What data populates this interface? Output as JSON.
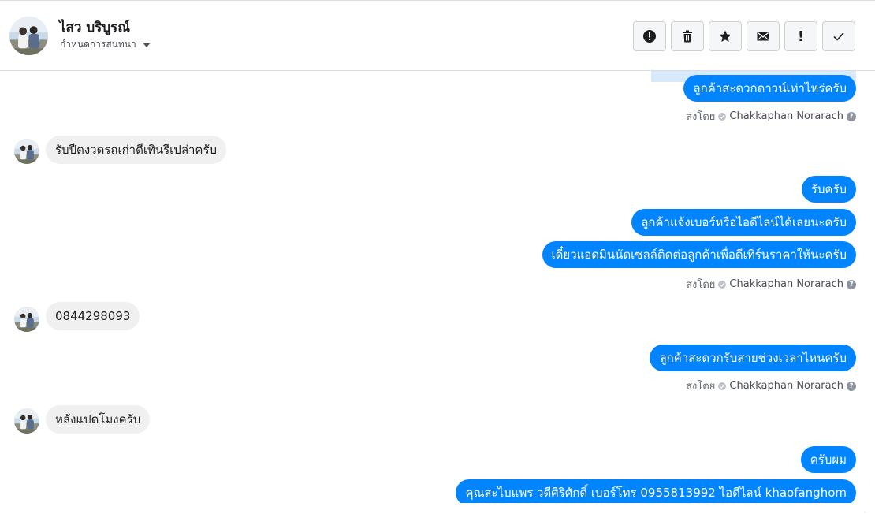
{
  "header": {
    "contact_name": "ไสว บริบูรณ์",
    "conversation_settings_label": "กำหนดการสนทนา",
    "actions": [
      {
        "icon": "report-spam-icon"
      },
      {
        "icon": "trash-icon"
      },
      {
        "icon": "star-icon"
      },
      {
        "icon": "envelope-icon"
      },
      {
        "icon": "exclamation-icon",
        "glyph": "!"
      },
      {
        "icon": "checkmark-icon"
      }
    ]
  },
  "messages": {
    "m1": "ลูกค้าสะดวกดาวน์เท่าไหร่ครับ",
    "sent1": {
      "prefix": "ส่งโดย",
      "author": "Chakkaphan Norarach"
    },
    "m2": "รับปีดงวดรถเก่าดีเทินรึเปล่าครับ",
    "m3": "รับครับ",
    "m4": "ลูกค้าแจ้งเบอร์หรือไอดีไลน์ได้เลยนะครับ",
    "m5": "เดี๋ยวแอดมินนัดเซลล์ติดต่อลูกค้าเพื่อดีเทิร์นราคาให้นะครับ",
    "sent2": {
      "prefix": "ส่งโดย",
      "author": "Chakkaphan Norarach"
    },
    "m6": "0844298093",
    "m7": "ลูกค้าสะดวกรับสายช่วงเวลาไหนครับ",
    "sent3": {
      "prefix": "ส่งโดย",
      "author": "Chakkaphan Norarach"
    },
    "m8": "หลังแปดโมงครับ",
    "m9": "ครับผม",
    "m10": "คุณสะไบแพร วดีศิริศักดิ์ เบอร์โทร 0955813992  ไอดีไลน์  khaofanghom"
  },
  "colors": {
    "outgoing_bubble": "#0084ff",
    "incoming_bubble": "#f1f0f0",
    "border": "#dadde1"
  }
}
